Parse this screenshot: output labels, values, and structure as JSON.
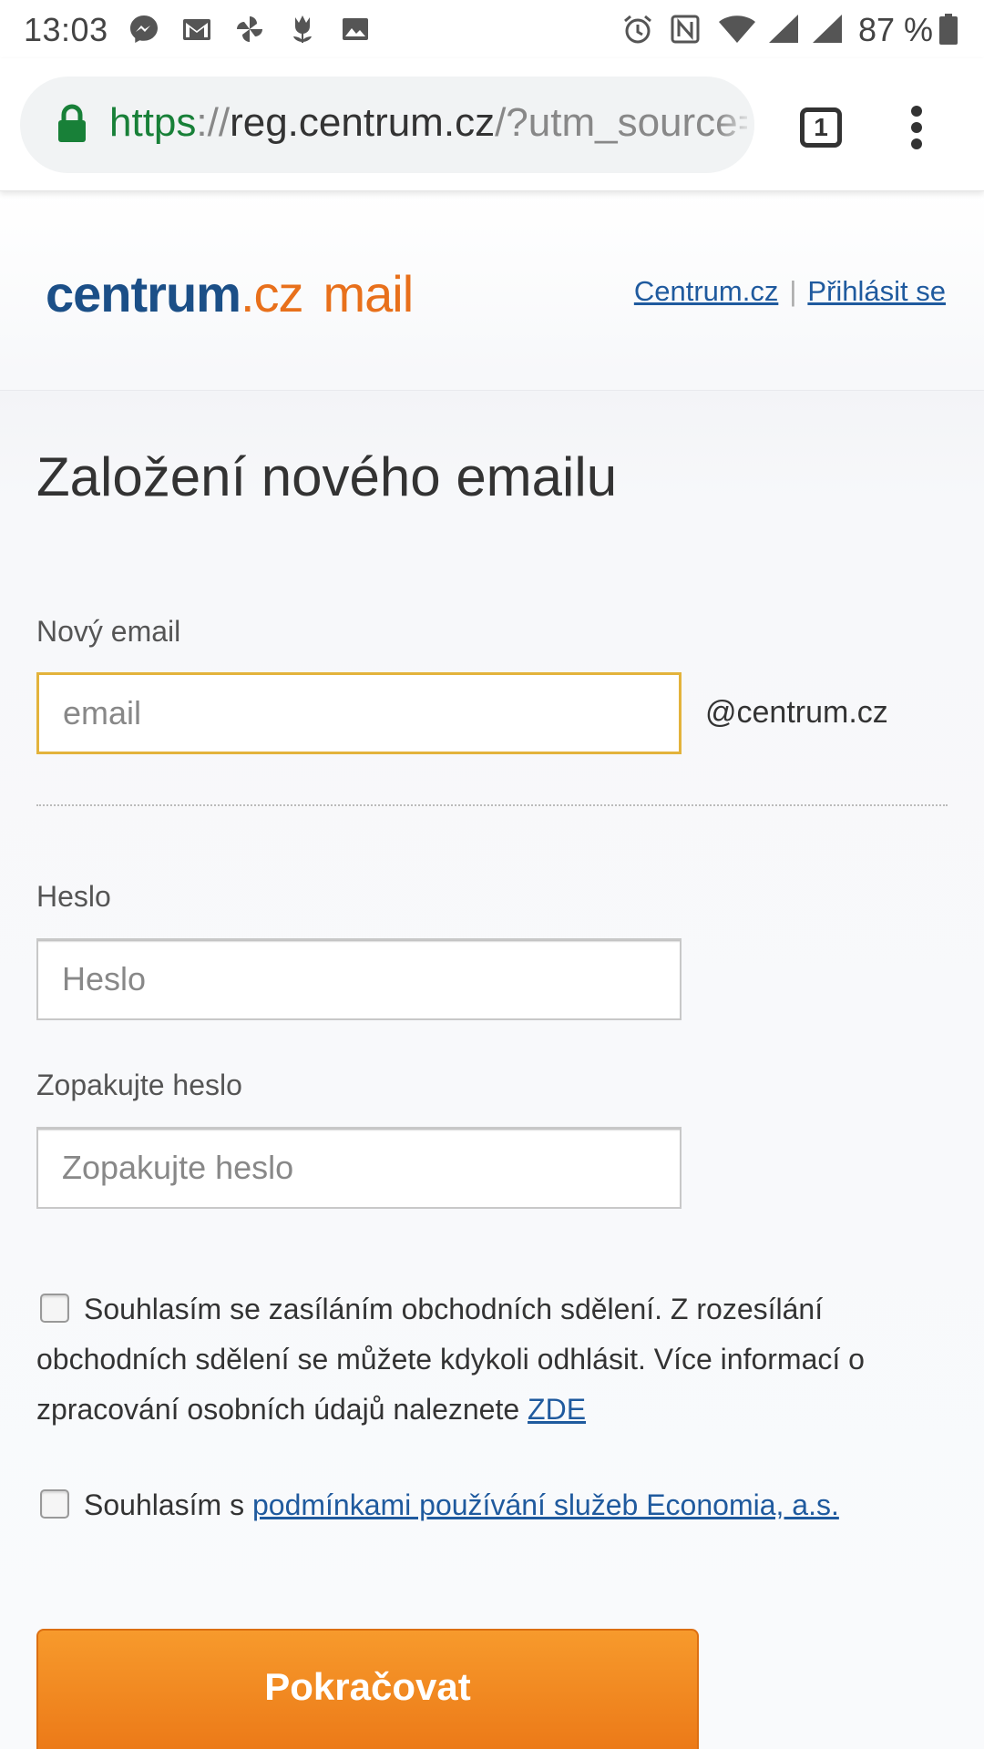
{
  "status_bar": {
    "time": "13:03",
    "battery": "87 %",
    "icons": [
      "messenger-icon",
      "gmail-icon",
      "pinwheel-icon",
      "tulip-icon",
      "gallery-icon",
      "alarm-icon",
      "nfc-icon",
      "wifi-icon",
      "signal-icon",
      "signal-icon",
      "battery-icon"
    ]
  },
  "browser": {
    "url_scheme": "https",
    "url_separator": "://",
    "url_host": "reg.centrum.cz",
    "url_path": "/?utm_source=",
    "tab_count": "1",
    "secure_color": "#188038"
  },
  "header": {
    "logo_word": "centrum",
    "logo_tld": ".cz",
    "logo_product": "mail",
    "links": [
      "Centrum.cz",
      "Přihlásit se"
    ],
    "divider": "|"
  },
  "form": {
    "title": "Založení nového emailu",
    "email_label": "Nový email",
    "email_placeholder": "email",
    "email_domain": "@centrum.cz",
    "password_label": "Heslo",
    "password_placeholder": "Heslo",
    "repeat_label": "Zopakujte heslo",
    "repeat_placeholder": "Zopakujte heslo",
    "consent_marketing": "Souhlasím se zasíláním obchodních sdělení. Z rozesílání obchodních sdělení se můžete kdykoli odhlásit. Více informací o zpracování osobních údajů naleznete ",
    "consent_marketing_link": "ZDE",
    "consent_terms_prefix": "Souhlasím s ",
    "consent_terms_link": "podmínkami používání služeb Economia, a.s.",
    "submit_label": "Pokračovat"
  },
  "colors": {
    "brand_blue": "#1b4f87",
    "brand_orange": "#e8701b",
    "link": "#1f5a9e",
    "focus_border": "#e3b33b",
    "button": "#f08a1f"
  }
}
